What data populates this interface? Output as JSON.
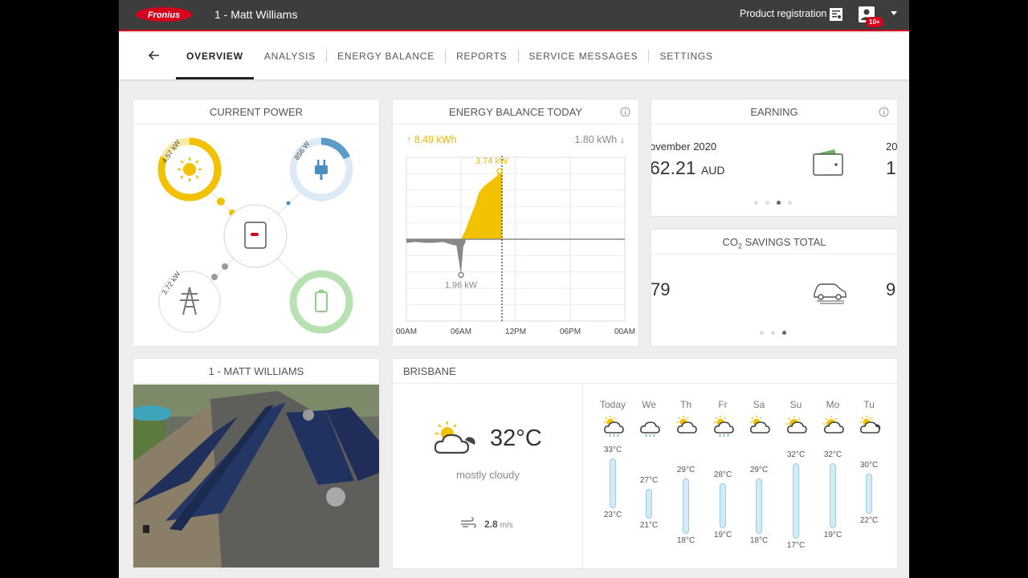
{
  "topbar": {
    "logo_text": "Fronius",
    "system_name": "1 - Matt Williams",
    "product_registration": "Product registration",
    "notification_count": "10+"
  },
  "nav": {
    "tabs": [
      {
        "label": "OVERVIEW",
        "active": true
      },
      {
        "label": "ANALYSIS",
        "active": false
      },
      {
        "label": "ENERGY BALANCE",
        "active": false
      },
      {
        "label": "REPORTS",
        "active": false
      },
      {
        "label": "SERVICE MESSAGES",
        "active": false
      },
      {
        "label": "SETTINGS",
        "active": false
      }
    ]
  },
  "current_power": {
    "title": "CURRENT POWER",
    "pv": "4.57 kW",
    "load": "856 W",
    "grid": "3.72 kW"
  },
  "energy_balance": {
    "title": "ENERGY BALANCE TODAY",
    "produced": "8.49 kWh",
    "consumed": "1.80 kWh",
    "peak_label": "3.74 kW",
    "min_label": "1.96 kW",
    "x_ticks": [
      "00AM",
      "06AM",
      "12PM",
      "06PM",
      "00AM"
    ]
  },
  "chart_data": {
    "type": "area",
    "title": "",
    "xlabel": "",
    "ylabel": "",
    "x_ticks": [
      "00AM",
      "06AM",
      "12PM",
      "06PM",
      "00AM"
    ],
    "annotations": [
      {
        "text": "3.74 kW",
        "x": "10:15",
        "y": 3.74
      },
      {
        "text": "1.96 kW",
        "x": "06:00",
        "y": -1.96
      }
    ],
    "series": [
      {
        "type": "production",
        "color": "#f2c100",
        "x": [
          "06:00",
          "06:30",
          "07:00",
          "07:30",
          "08:00",
          "08:30",
          "09:00",
          "09:30",
          "10:00",
          "10:15",
          "10:30"
        ],
        "values": [
          0.0,
          0.5,
          1.2,
          1.8,
          2.6,
          2.9,
          3.1,
          3.3,
          3.5,
          3.74,
          3.7
        ]
      },
      {
        "type": "consumption",
        "color": "#888888",
        "x": [
          "00:00",
          "01:00",
          "02:00",
          "03:00",
          "04:00",
          "05:00",
          "05:30",
          "06:00",
          "06:15",
          "06:30"
        ],
        "values": [
          -0.2,
          -0.15,
          -0.2,
          -0.2,
          -0.15,
          -0.3,
          -0.35,
          -1.96,
          -0.4,
          -0.15
        ]
      }
    ],
    "now_marker": "10:30",
    "grid": true
  },
  "earning": {
    "title": "EARNING",
    "month": "ovember 2020",
    "value": "62.21",
    "unit": "AUD",
    "next_month": "20",
    "next_value": "1,"
  },
  "co2": {
    "title_prefix": "CO",
    "title_sub": "2",
    "title_suffix": " SAVINGS TOTAL",
    "value": "79",
    "next_value": "9"
  },
  "photo_card": {
    "title": "1 - MATT WILLIAMS"
  },
  "weather": {
    "title": "BRISBANE",
    "temp": "32°C",
    "condition": "mostly cloudy",
    "wind_speed": "2.8",
    "wind_unit": "m/s",
    "days": [
      {
        "label": "Today",
        "high": "33°C",
        "low": "23°C",
        "high_val": 33,
        "low_val": 23,
        "icon": "partly-sunny-rain-icon"
      },
      {
        "label": "We",
        "high": "27°C",
        "low": "21°C",
        "high_val": 27,
        "low_val": 21,
        "icon": "rain-cloud-icon"
      },
      {
        "label": "Th",
        "high": "29°C",
        "low": "18°C",
        "high_val": 29,
        "low_val": 18,
        "icon": "partly-sunny-icon"
      },
      {
        "label": "Fr",
        "high": "28°C",
        "low": "19°C",
        "high_val": 28,
        "low_val": 19,
        "icon": "partly-sunny-rain-icon"
      },
      {
        "label": "Sa",
        "high": "29°C",
        "low": "18°C",
        "high_val": 29,
        "low_val": 18,
        "icon": "partly-sunny-icon"
      },
      {
        "label": "Su",
        "high": "32°C",
        "low": "17°C",
        "high_val": 32,
        "low_val": 17,
        "icon": "sunny-cloud-icon"
      },
      {
        "label": "Mo",
        "high": "32°C",
        "low": "19°C",
        "high_val": 32,
        "low_val": 19,
        "icon": "sunny-cloud-icon"
      },
      {
        "label": "Tu",
        "high": "30°C",
        "low": "22°C",
        "high_val": 30,
        "low_val": 22,
        "icon": "partly-sunny-dark-icon"
      }
    ]
  }
}
